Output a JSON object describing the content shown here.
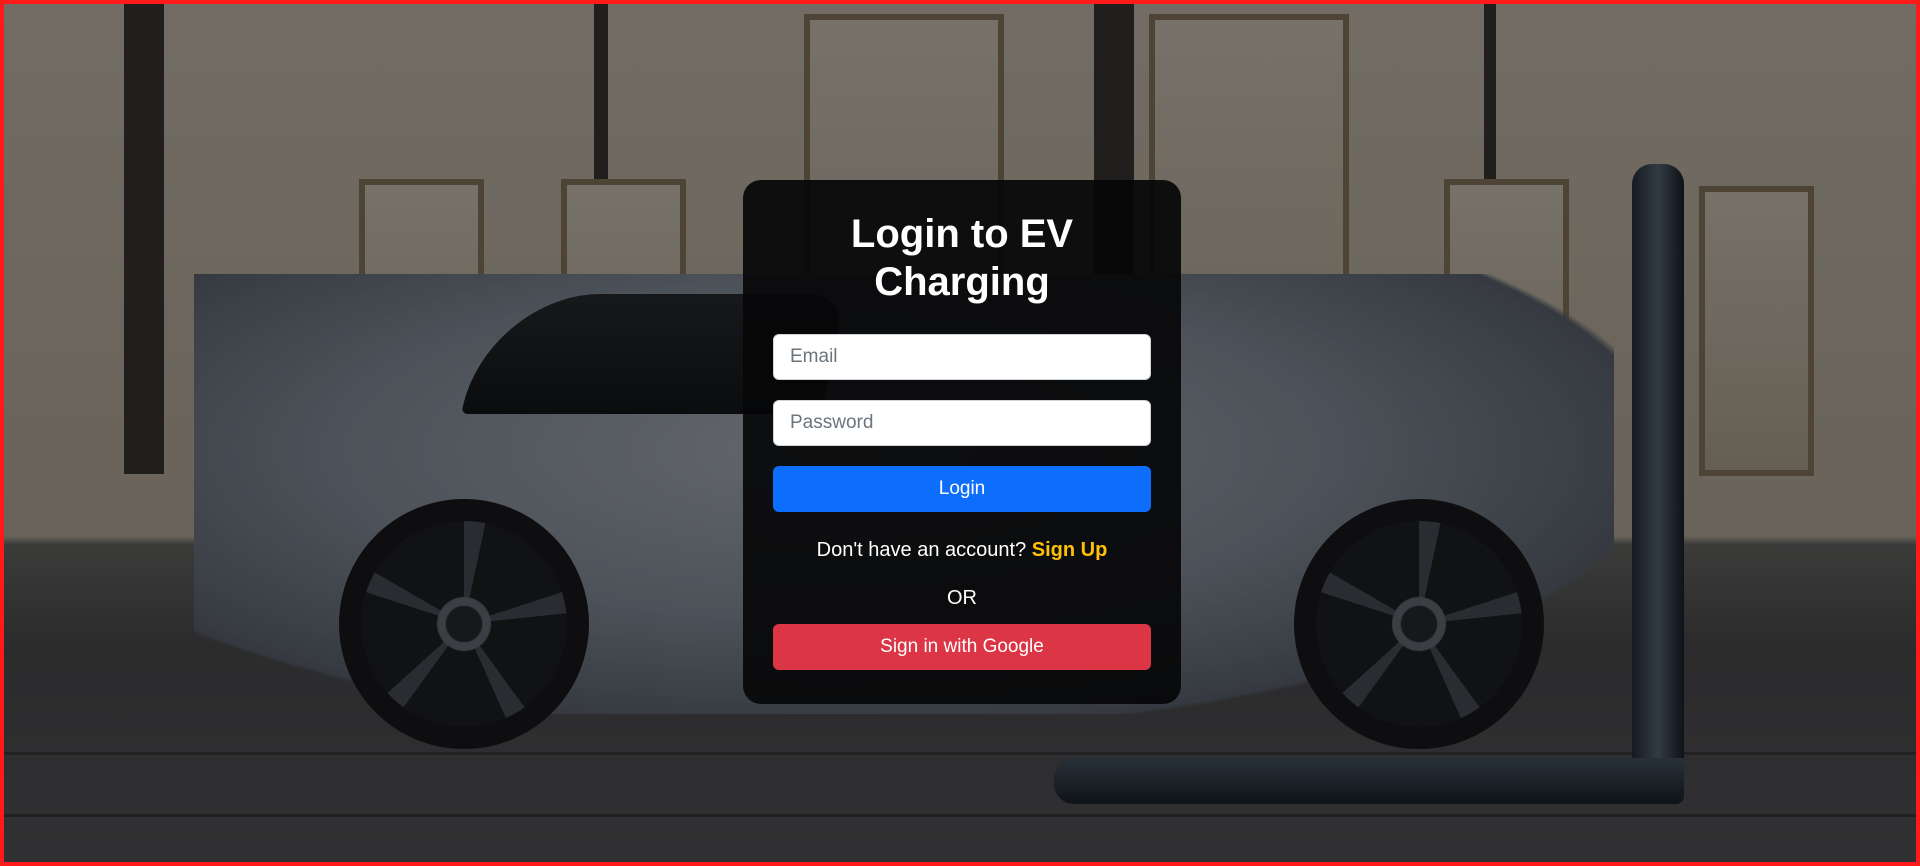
{
  "card": {
    "title": "Login to EV Charging",
    "email_placeholder": "Email",
    "password_placeholder": "Password",
    "login_label": "Login",
    "signup_prompt": "Don't have an account?",
    "signup_link": "Sign Up",
    "or_text": "OR",
    "google_label": "Sign in with Google"
  },
  "colors": {
    "login_button": "#0d6efd",
    "google_button": "#dc3545",
    "signup_link": "#ffc107",
    "page_border": "#ff1a1a",
    "card_background": "#060608"
  }
}
